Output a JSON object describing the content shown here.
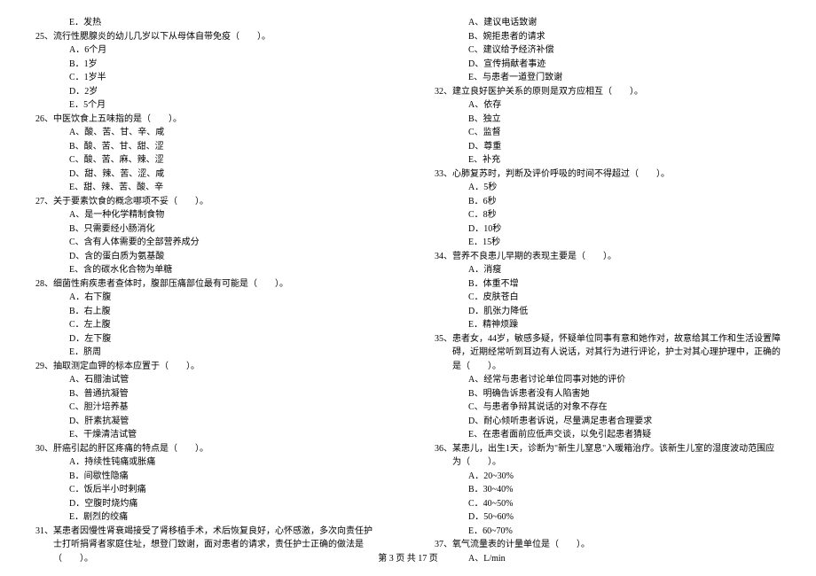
{
  "col1": {
    "q24eopt": "E．发热",
    "q25": {
      "num": "25、",
      "text": "流行性腮腺炎的幼儿几岁以下从母体自带免疫（　　）。",
      "a": "A．6个月",
      "b": "B．1岁",
      "c": "C．1岁半",
      "d": "D．2岁",
      "e": "E．5个月"
    },
    "q26": {
      "num": "26、",
      "text": "中医饮食上五味指的是（　　）。",
      "a": "A、酸、苦、甘、辛、咸",
      "b": "B、酸、苦、甘、甜、涩",
      "c": "C、酸、苦、麻、辣、涩",
      "d": "D、甜、辣、苦、涩、咸",
      "e": "E、甜、辣、苦、酸、辛"
    },
    "q27": {
      "num": "27、",
      "text": "关于要素饮食的概念哪项不妥（　　）。",
      "a": "A、是一种化学精制食物",
      "b": "B、只需要经小肠消化",
      "c": "C、含有人体需要的全部营养成分",
      "d": "D、含的蛋白质为氨基酸",
      "e": "E、含的碳水化合物为单糖"
    },
    "q28": {
      "num": "28、",
      "text": "细菌性痢疾患者查体时，腹部压痛部位最有可能是（　　）。",
      "a": "A．右下腹",
      "b": "B．右上腹",
      "c": "C．左上腹",
      "d": "D．左下腹",
      "e": "E．脐周"
    },
    "q29": {
      "num": "29、",
      "text": "抽取测定血钾的标本应置于（　　）。",
      "a": "A、石腊油试管",
      "b": "B、普通抗凝管",
      "c": "C、胆汁培养基",
      "d": "D、肝素抗凝管",
      "e": "E、干燥清洁试管"
    },
    "q30": {
      "num": "30、",
      "text": "肝癌引起的肝区疼痛的特点是（　　）。",
      "a": "A．持续性钝痛或胀痛",
      "b": "B．间歇性隐痛",
      "c": "C．饭后半小时剌痛",
      "d": "D．空腹时烧灼痛",
      "e": "E．剧烈的绞痛"
    },
    "q31": {
      "num": "31、",
      "text": "某患者因慢性肾衰竭接受了肾移植手术，术后恢复良好，心怀感激，多次向责任护士打听捐肾者家庭住址，想登门致谢，面对患者的请求，责任护士正确的做法是（　　）。"
    }
  },
  "col2": {
    "q31opts": {
      "a": "A、建议电话致谢",
      "b": "B、婉拒患者的请求",
      "c": "C、建议给予经济补偿",
      "d": "D、宣传捐献者事迹",
      "e": "E、与患者一道登门致谢"
    },
    "q32": {
      "num": "32、",
      "text": "建立良好医护关系的原则是双方应相互（　　）。",
      "a": "A、依存",
      "b": "B、独立",
      "c": "C、监督",
      "d": "D、尊重",
      "e": "E、补充"
    },
    "q33": {
      "num": "33、",
      "text": "心肺复苏时，判断及评价呼吸的时间不得超过（　　）。",
      "a": "A．5秒",
      "b": "B．6秒",
      "c": "C．8秒",
      "d": "D．10秒",
      "e": "E．15秒"
    },
    "q34": {
      "num": "34、",
      "text": "营养不良患儿早期的表现主要是（　　）。",
      "a": "A．消瘦",
      "b": "B．体重不增",
      "c": "C．皮肤苍白",
      "d": "D．肌张力降低",
      "e": "E．精神烦躁"
    },
    "q35": {
      "num": "35、",
      "text": "患者女，44岁，敏感多疑，怀疑单位同事有意和她作对，故意给其工作和生活设置障碍，近期经常听到耳边有人说话，对其行为进行评论，护士对其心理护理中，正确的是（　　）。",
      "a": "A、经常与患者讨论单位同事对她的评价",
      "b": "B、明确告诉患者没有人陷害她",
      "c": "C、与患者争辩其说话的对象不存在",
      "d": "D、耐心倾听患者诉说，尽量满足患者合理要求",
      "e": "E、在患者面前应低声交谈，以免引起患者猜疑"
    },
    "q36": {
      "num": "36、",
      "text": "某患儿，出生1天，诊断为\"新生儿窒息\"入暖箱治疗。该新生儿室的湿度波动范围应为（　　）。",
      "a": "A．20~30%",
      "b": "B．30~40%",
      "c": "C．40~50%",
      "d": "D．50~60%",
      "e": "E．60~70%"
    },
    "q37": {
      "num": "37、",
      "text": "氧气流量表的计量单位是（　　）。",
      "a": "A、L/min"
    }
  },
  "footer": "第 3 页 共 17 页"
}
